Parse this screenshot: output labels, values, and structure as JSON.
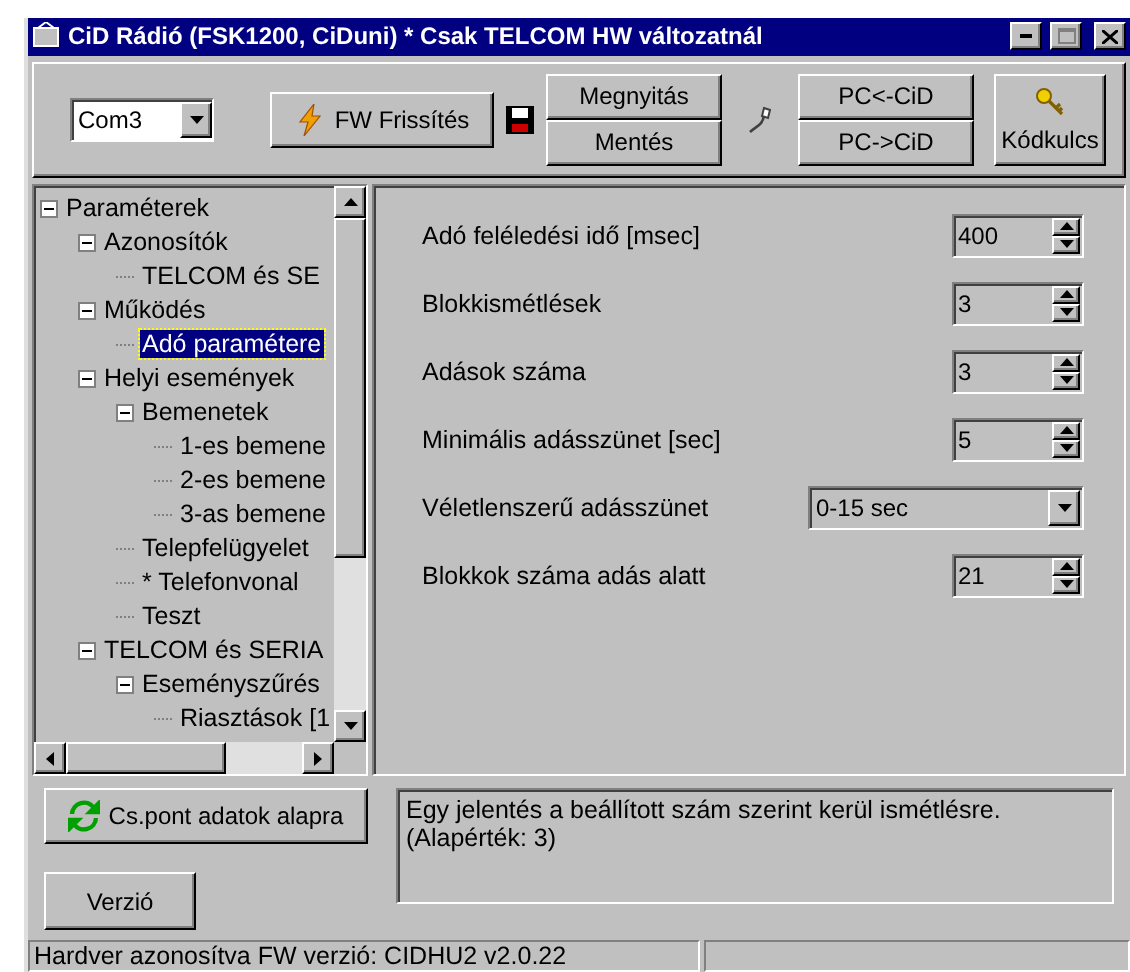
{
  "window": {
    "title": "CiD Rádió (FSK1200, CiDuni)  * Csak TELCOM HW változatnál"
  },
  "toolbar": {
    "port": "Com3",
    "fw_button": "FW Frissítés",
    "open_button": "Megnyitás",
    "save_button": "Mentés",
    "read_button": "PC<-CiD",
    "write_button": "PC->CiD",
    "key_button": "Kódkulcs"
  },
  "tree": [
    {
      "label": "Paraméterek",
      "expanded": true,
      "selected": false,
      "children": [
        {
          "label": "Azonosítók",
          "expanded": true,
          "selected": false,
          "children": [
            {
              "label": "TELCOM és SE",
              "selected": false
            }
          ]
        },
        {
          "label": "Működés",
          "expanded": true,
          "selected": false,
          "children": [
            {
              "label": "Adó paramétere",
              "selected": true
            }
          ]
        },
        {
          "label": "Helyi események",
          "expanded": true,
          "selected": false,
          "children": [
            {
              "label": "Bemenetek",
              "expanded": true,
              "selected": false,
              "children": [
                {
                  "label": "1-es bemene",
                  "selected": false
                },
                {
                  "label": "2-es bemene",
                  "selected": false
                },
                {
                  "label": "3-as bemene",
                  "selected": false
                }
              ]
            },
            {
              "label": "Telepfelügyelet",
              "selected": false
            },
            {
              "label": "* Telefonvonal",
              "selected": false
            },
            {
              "label": "Teszt",
              "selected": false
            }
          ]
        },
        {
          "label": "TELCOM és SERIA",
          "expanded": true,
          "selected": false,
          "children": [
            {
              "label": "Eseményszűrés",
              "expanded": true,
              "selected": false,
              "children": [
                {
                  "label": "Riasztások [1",
                  "selected": false
                }
              ]
            }
          ]
        }
      ]
    }
  ],
  "settings": [
    {
      "kind": "spin",
      "label": "Adó feléledési idő [msec]",
      "value": "400"
    },
    {
      "kind": "spin",
      "label": "Blokkismétlések",
      "value": "3"
    },
    {
      "kind": "spin",
      "label": "Adások száma",
      "value": "3"
    },
    {
      "kind": "spin",
      "label": "Minimális adásszünet [sec]",
      "value": "5"
    },
    {
      "kind": "dropdown",
      "label": "Véletlenszerű adásszünet",
      "value": "0-15 sec"
    },
    {
      "kind": "spin",
      "label": "Blokkok száma adás alatt",
      "value": "21"
    }
  ],
  "bottom": {
    "defaults_button": "Cs.pont adatok alapra",
    "version_button": "Verzió",
    "help_text": "Egy jelentés a beállított szám szerint kerül ismétlésre.\n(Alapérték: 3)"
  },
  "status_bar": [
    "Hardver azonosítva FW verzió: CIDHU2 v2.0.22"
  ]
}
